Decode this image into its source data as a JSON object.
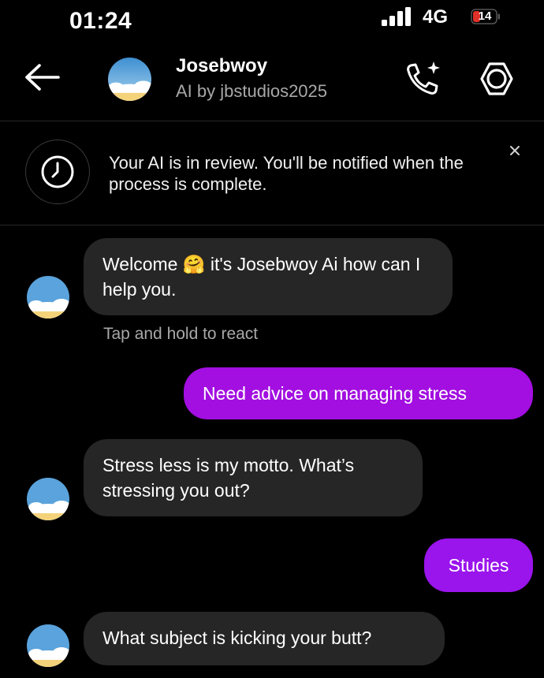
{
  "status_bar": {
    "time": "01:24",
    "network": "4G",
    "battery": "14"
  },
  "header": {
    "name": "Josebwoy",
    "subtitle": "AI by jbstudios2025",
    "icons": [
      "back-arrow-icon",
      "call-sparkle-icon",
      "settings-icon"
    ]
  },
  "notice": {
    "text": "Your AI is in review. You'll be notified when the process is complete.",
    "close_symbol": "×"
  },
  "messages": [
    {
      "from": "bot",
      "text": "Welcome 🤗 it's Josebwoy Ai how can I help you."
    },
    {
      "from": "user",
      "text": "Need advice on managing stress"
    },
    {
      "from": "bot",
      "text": "Stress less is my motto. What’s stressing you out?"
    },
    {
      "from": "user",
      "text": "Studies"
    },
    {
      "from": "bot",
      "text": "What subject is kicking your butt?"
    }
  ],
  "hint": "Tap and hold to react",
  "colors": {
    "background": "#000000",
    "bot_bubble": "#262626",
    "user_bubble": "#a20fe0",
    "battery_low": "#e0302a",
    "secondary_text": "#a8a8a8"
  }
}
